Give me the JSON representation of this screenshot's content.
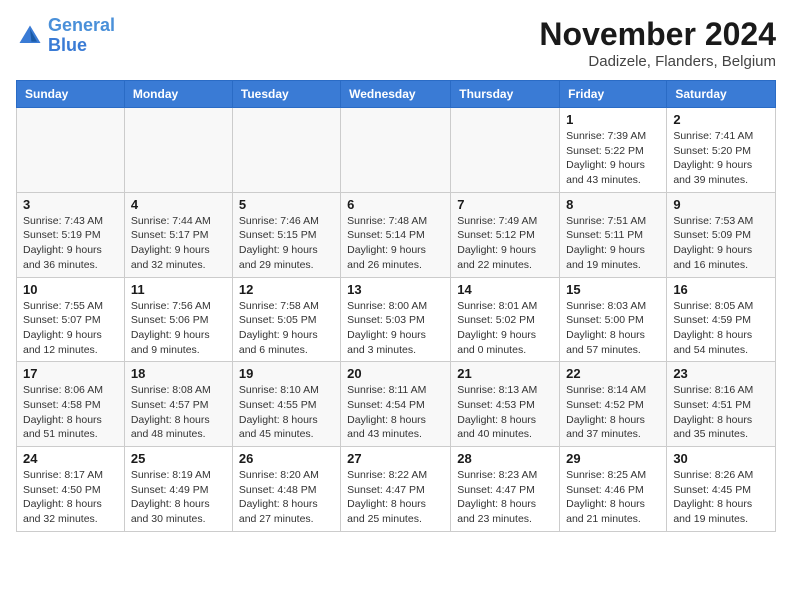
{
  "header": {
    "logo_text_normal": "General",
    "logo_text_colored": "Blue",
    "month_title": "November 2024",
    "location": "Dadizele, Flanders, Belgium"
  },
  "calendar": {
    "days_of_week": [
      "Sunday",
      "Monday",
      "Tuesday",
      "Wednesday",
      "Thursday",
      "Friday",
      "Saturday"
    ],
    "weeks": [
      [
        {
          "day": "",
          "info": ""
        },
        {
          "day": "",
          "info": ""
        },
        {
          "day": "",
          "info": ""
        },
        {
          "day": "",
          "info": ""
        },
        {
          "day": "",
          "info": ""
        },
        {
          "day": "1",
          "info": "Sunrise: 7:39 AM\nSunset: 5:22 PM\nDaylight: 9 hours and 43 minutes."
        },
        {
          "day": "2",
          "info": "Sunrise: 7:41 AM\nSunset: 5:20 PM\nDaylight: 9 hours and 39 minutes."
        }
      ],
      [
        {
          "day": "3",
          "info": "Sunrise: 7:43 AM\nSunset: 5:19 PM\nDaylight: 9 hours and 36 minutes."
        },
        {
          "day": "4",
          "info": "Sunrise: 7:44 AM\nSunset: 5:17 PM\nDaylight: 9 hours and 32 minutes."
        },
        {
          "day": "5",
          "info": "Sunrise: 7:46 AM\nSunset: 5:15 PM\nDaylight: 9 hours and 29 minutes."
        },
        {
          "day": "6",
          "info": "Sunrise: 7:48 AM\nSunset: 5:14 PM\nDaylight: 9 hours and 26 minutes."
        },
        {
          "day": "7",
          "info": "Sunrise: 7:49 AM\nSunset: 5:12 PM\nDaylight: 9 hours and 22 minutes."
        },
        {
          "day": "8",
          "info": "Sunrise: 7:51 AM\nSunset: 5:11 PM\nDaylight: 9 hours and 19 minutes."
        },
        {
          "day": "9",
          "info": "Sunrise: 7:53 AM\nSunset: 5:09 PM\nDaylight: 9 hours and 16 minutes."
        }
      ],
      [
        {
          "day": "10",
          "info": "Sunrise: 7:55 AM\nSunset: 5:07 PM\nDaylight: 9 hours and 12 minutes."
        },
        {
          "day": "11",
          "info": "Sunrise: 7:56 AM\nSunset: 5:06 PM\nDaylight: 9 hours and 9 minutes."
        },
        {
          "day": "12",
          "info": "Sunrise: 7:58 AM\nSunset: 5:05 PM\nDaylight: 9 hours and 6 minutes."
        },
        {
          "day": "13",
          "info": "Sunrise: 8:00 AM\nSunset: 5:03 PM\nDaylight: 9 hours and 3 minutes."
        },
        {
          "day": "14",
          "info": "Sunrise: 8:01 AM\nSunset: 5:02 PM\nDaylight: 9 hours and 0 minutes."
        },
        {
          "day": "15",
          "info": "Sunrise: 8:03 AM\nSunset: 5:00 PM\nDaylight: 8 hours and 57 minutes."
        },
        {
          "day": "16",
          "info": "Sunrise: 8:05 AM\nSunset: 4:59 PM\nDaylight: 8 hours and 54 minutes."
        }
      ],
      [
        {
          "day": "17",
          "info": "Sunrise: 8:06 AM\nSunset: 4:58 PM\nDaylight: 8 hours and 51 minutes."
        },
        {
          "day": "18",
          "info": "Sunrise: 8:08 AM\nSunset: 4:57 PM\nDaylight: 8 hours and 48 minutes."
        },
        {
          "day": "19",
          "info": "Sunrise: 8:10 AM\nSunset: 4:55 PM\nDaylight: 8 hours and 45 minutes."
        },
        {
          "day": "20",
          "info": "Sunrise: 8:11 AM\nSunset: 4:54 PM\nDaylight: 8 hours and 43 minutes."
        },
        {
          "day": "21",
          "info": "Sunrise: 8:13 AM\nSunset: 4:53 PM\nDaylight: 8 hours and 40 minutes."
        },
        {
          "day": "22",
          "info": "Sunrise: 8:14 AM\nSunset: 4:52 PM\nDaylight: 8 hours and 37 minutes."
        },
        {
          "day": "23",
          "info": "Sunrise: 8:16 AM\nSunset: 4:51 PM\nDaylight: 8 hours and 35 minutes."
        }
      ],
      [
        {
          "day": "24",
          "info": "Sunrise: 8:17 AM\nSunset: 4:50 PM\nDaylight: 8 hours and 32 minutes."
        },
        {
          "day": "25",
          "info": "Sunrise: 8:19 AM\nSunset: 4:49 PM\nDaylight: 8 hours and 30 minutes."
        },
        {
          "day": "26",
          "info": "Sunrise: 8:20 AM\nSunset: 4:48 PM\nDaylight: 8 hours and 27 minutes."
        },
        {
          "day": "27",
          "info": "Sunrise: 8:22 AM\nSunset: 4:47 PM\nDaylight: 8 hours and 25 minutes."
        },
        {
          "day": "28",
          "info": "Sunrise: 8:23 AM\nSunset: 4:47 PM\nDaylight: 8 hours and 23 minutes."
        },
        {
          "day": "29",
          "info": "Sunrise: 8:25 AM\nSunset: 4:46 PM\nDaylight: 8 hours and 21 minutes."
        },
        {
          "day": "30",
          "info": "Sunrise: 8:26 AM\nSunset: 4:45 PM\nDaylight: 8 hours and 19 minutes."
        }
      ]
    ]
  }
}
